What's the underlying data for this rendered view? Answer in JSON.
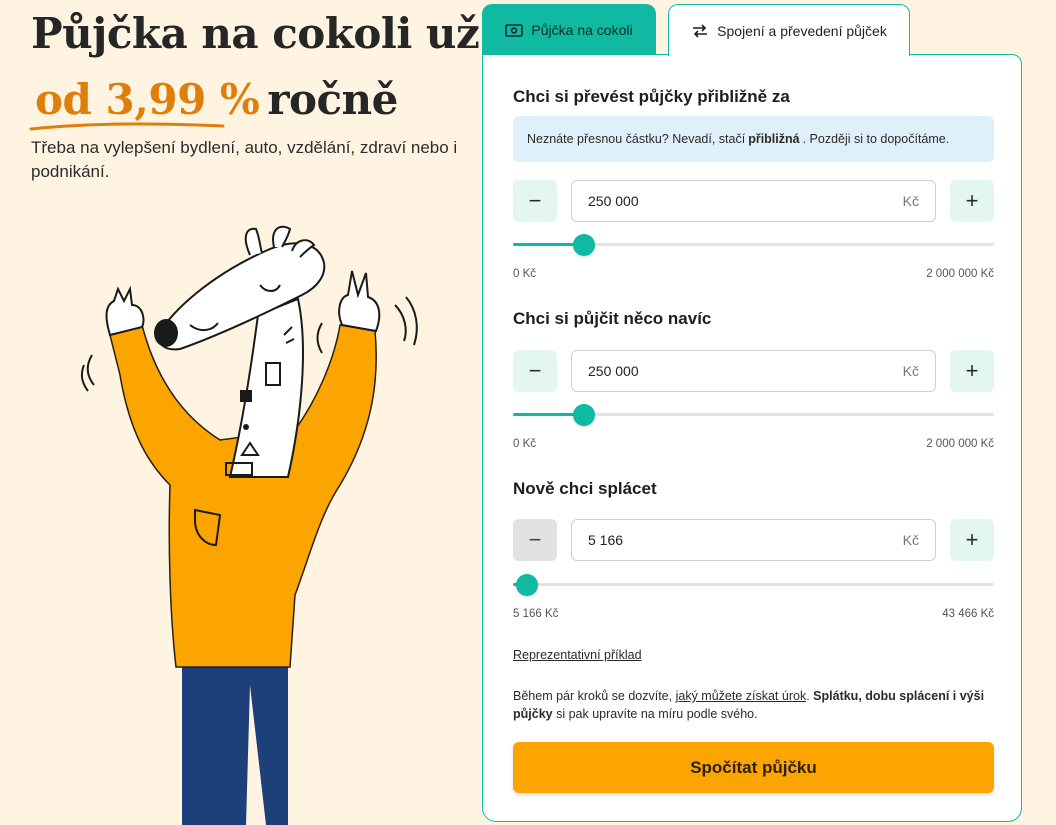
{
  "hero": {
    "title_line1": "Půjčka na cokoli už",
    "rate": "od 3,99 %",
    "title_suffix": "ročně",
    "subtitle": "Třeba na vylepšení bydlení, auto, vzdělání, zdraví nebo i podnikání."
  },
  "tabs": [
    {
      "label": "Půjčka na cokoli",
      "icon": "banknote-icon",
      "active": false
    },
    {
      "label": "Spojení a převedení půjček",
      "icon": "swap-arrows-icon",
      "active": true
    }
  ],
  "calculator": {
    "transfer": {
      "title": "Chci si převést půjčky přibližně za",
      "info_pre": "Neznáte přesnou částku? Nevadí, stačí",
      "info_bold": "přibližná",
      "info_post": ". Později si to dopočítáme.",
      "value": "250 000",
      "unit": "Kč",
      "min_label": "0 Kč",
      "max_label": "2 000 000 Kč",
      "fraction": 0.148
    },
    "extra": {
      "title": "Chci si půjčit něco navíc",
      "value": "250 000",
      "unit": "Kč",
      "min_label": "0 Kč",
      "max_label": "2 000 000 Kč",
      "fraction": 0.148
    },
    "repay": {
      "title": "Nově chci splácet",
      "value": "5 166",
      "unit": "Kč",
      "min_label": "5 166 Kč",
      "max_label": "43 466 Kč",
      "fraction": 0.03
    },
    "minus_label": "−",
    "plus_label": "+",
    "representative_link": "Reprezentativní příklad",
    "fine_pre": "Během pár kroků se dozvíte,",
    "fine_link": "jaký můžete získat úrok",
    "fine_dot": ".",
    "fine_bold": "Splátku, dobu splácení i výši půjčky",
    "fine_post": "si pak upravíte na míru podle svého.",
    "cta": "Spočítat půjčku"
  },
  "colors": {
    "background": "#fff4e2",
    "accent": "#10b9a2",
    "rate": "#df7f0b",
    "cta": "#fca500",
    "sweater": "#fca500",
    "jeans": "#1d3f7a"
  }
}
